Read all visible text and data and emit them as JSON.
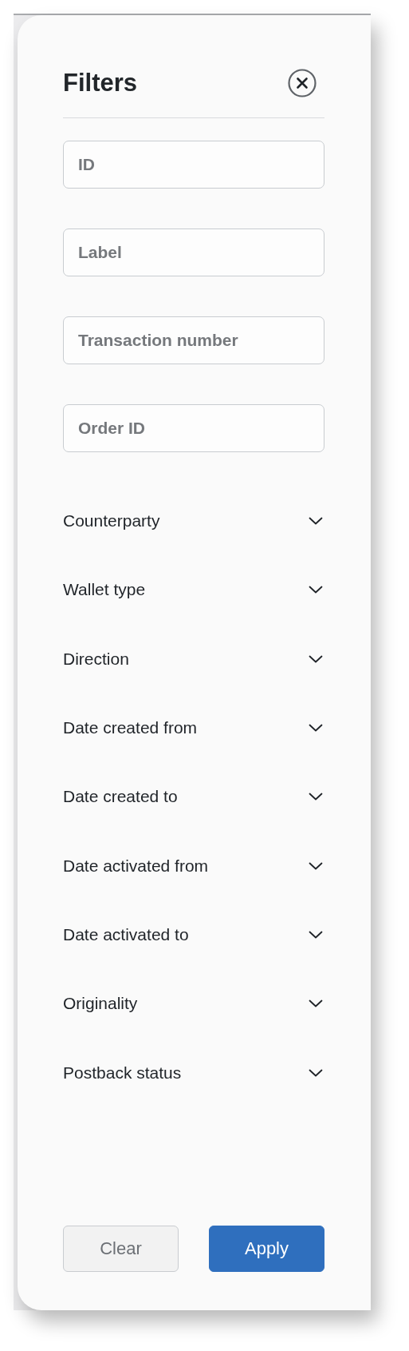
{
  "panel": {
    "title": "Filters"
  },
  "fields": [
    {
      "placeholder": "ID"
    },
    {
      "placeholder": "Label"
    },
    {
      "placeholder": "Transaction number"
    },
    {
      "placeholder": "Order ID"
    }
  ],
  "dropdowns": [
    {
      "label": "Counterparty",
      "expanded": false
    },
    {
      "label": "Wallet type",
      "expanded": false
    },
    {
      "label": "Direction",
      "expanded": false
    },
    {
      "label": "Date created from",
      "expanded": false
    },
    {
      "label": "Date created to",
      "expanded": false
    },
    {
      "label": "Date activated from",
      "expanded": false
    },
    {
      "label": "Date activated to",
      "expanded": false
    },
    {
      "label": "Originality",
      "expanded": false
    },
    {
      "label": "Postback status",
      "expanded": false
    }
  ],
  "buttons": [
    {
      "label": "Clear",
      "kind": "secondary"
    },
    {
      "label": "Apply",
      "kind": "primary"
    }
  ]
}
